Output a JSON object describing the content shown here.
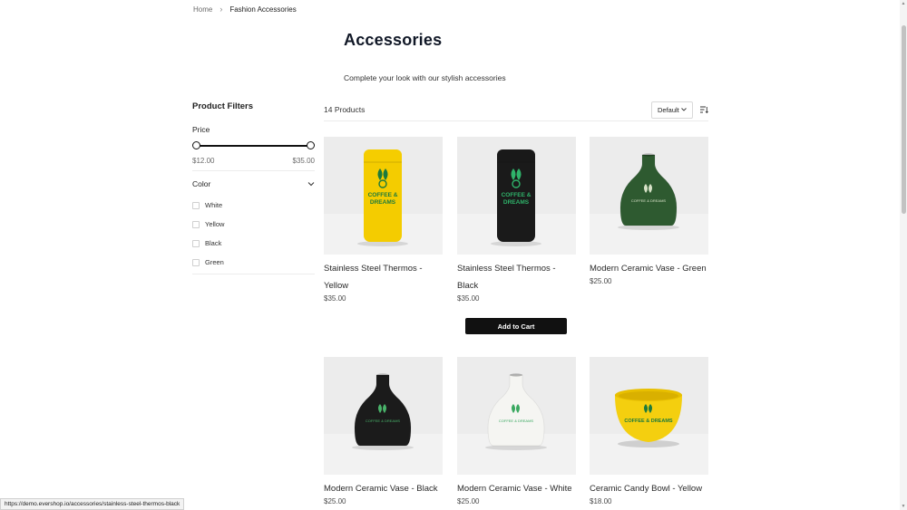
{
  "breadcrumb": {
    "home": "Home",
    "separator": "›",
    "current": "Fashion Accessories"
  },
  "page": {
    "title": "Accessories",
    "subtitle": "Complete your look with our stylish accessories"
  },
  "filters": {
    "title": "Product Filters",
    "price": {
      "label": "Price",
      "min": "$12.00",
      "max": "$35.00"
    },
    "color": {
      "label": "Color",
      "options": [
        "White",
        "Yellow",
        "Black",
        "Green"
      ]
    }
  },
  "toolbar": {
    "count": "14 Products",
    "sort_value": "Default"
  },
  "products": [
    {
      "name": "Stainless Steel Thermos - Yellow",
      "price": "$35.00",
      "color": "#f4cc00",
      "shape": "thermos",
      "print": "#1c7a3c"
    },
    {
      "name": "Stainless Steel Thermos - Black",
      "price": "$35.00",
      "color": "#1a1a1a",
      "shape": "thermos",
      "print": "#2fb36a"
    },
    {
      "name": "Modern Ceramic Vase - Green",
      "price": "$25.00",
      "color": "#2e5a30",
      "shape": "vase",
      "print": "#d8e2c8"
    },
    {
      "name": "Modern Ceramic Vase - Black",
      "price": "$25.00",
      "color": "#1b1b1b",
      "shape": "vase",
      "print": "#49b36a"
    },
    {
      "name": "Modern Ceramic Vase - White",
      "price": "$25.00",
      "color": "#f5f5f2",
      "shape": "vase",
      "print": "#3aa860"
    },
    {
      "name": "Ceramic Candy Bowl - Yellow",
      "price": "$18.00",
      "color": "#f4cf0f",
      "shape": "bowl",
      "print": "#1c7a3c"
    }
  ],
  "product_labels": {
    "logo_line1": "COFFEE &",
    "logo_line2": "DREAMS",
    "logo_full": "COFFEE & DREAMS"
  },
  "add_to_cart": "Add to Cart",
  "status_url": "https://demo.evershop.io/accessories/stainless-steel-thermos-black"
}
